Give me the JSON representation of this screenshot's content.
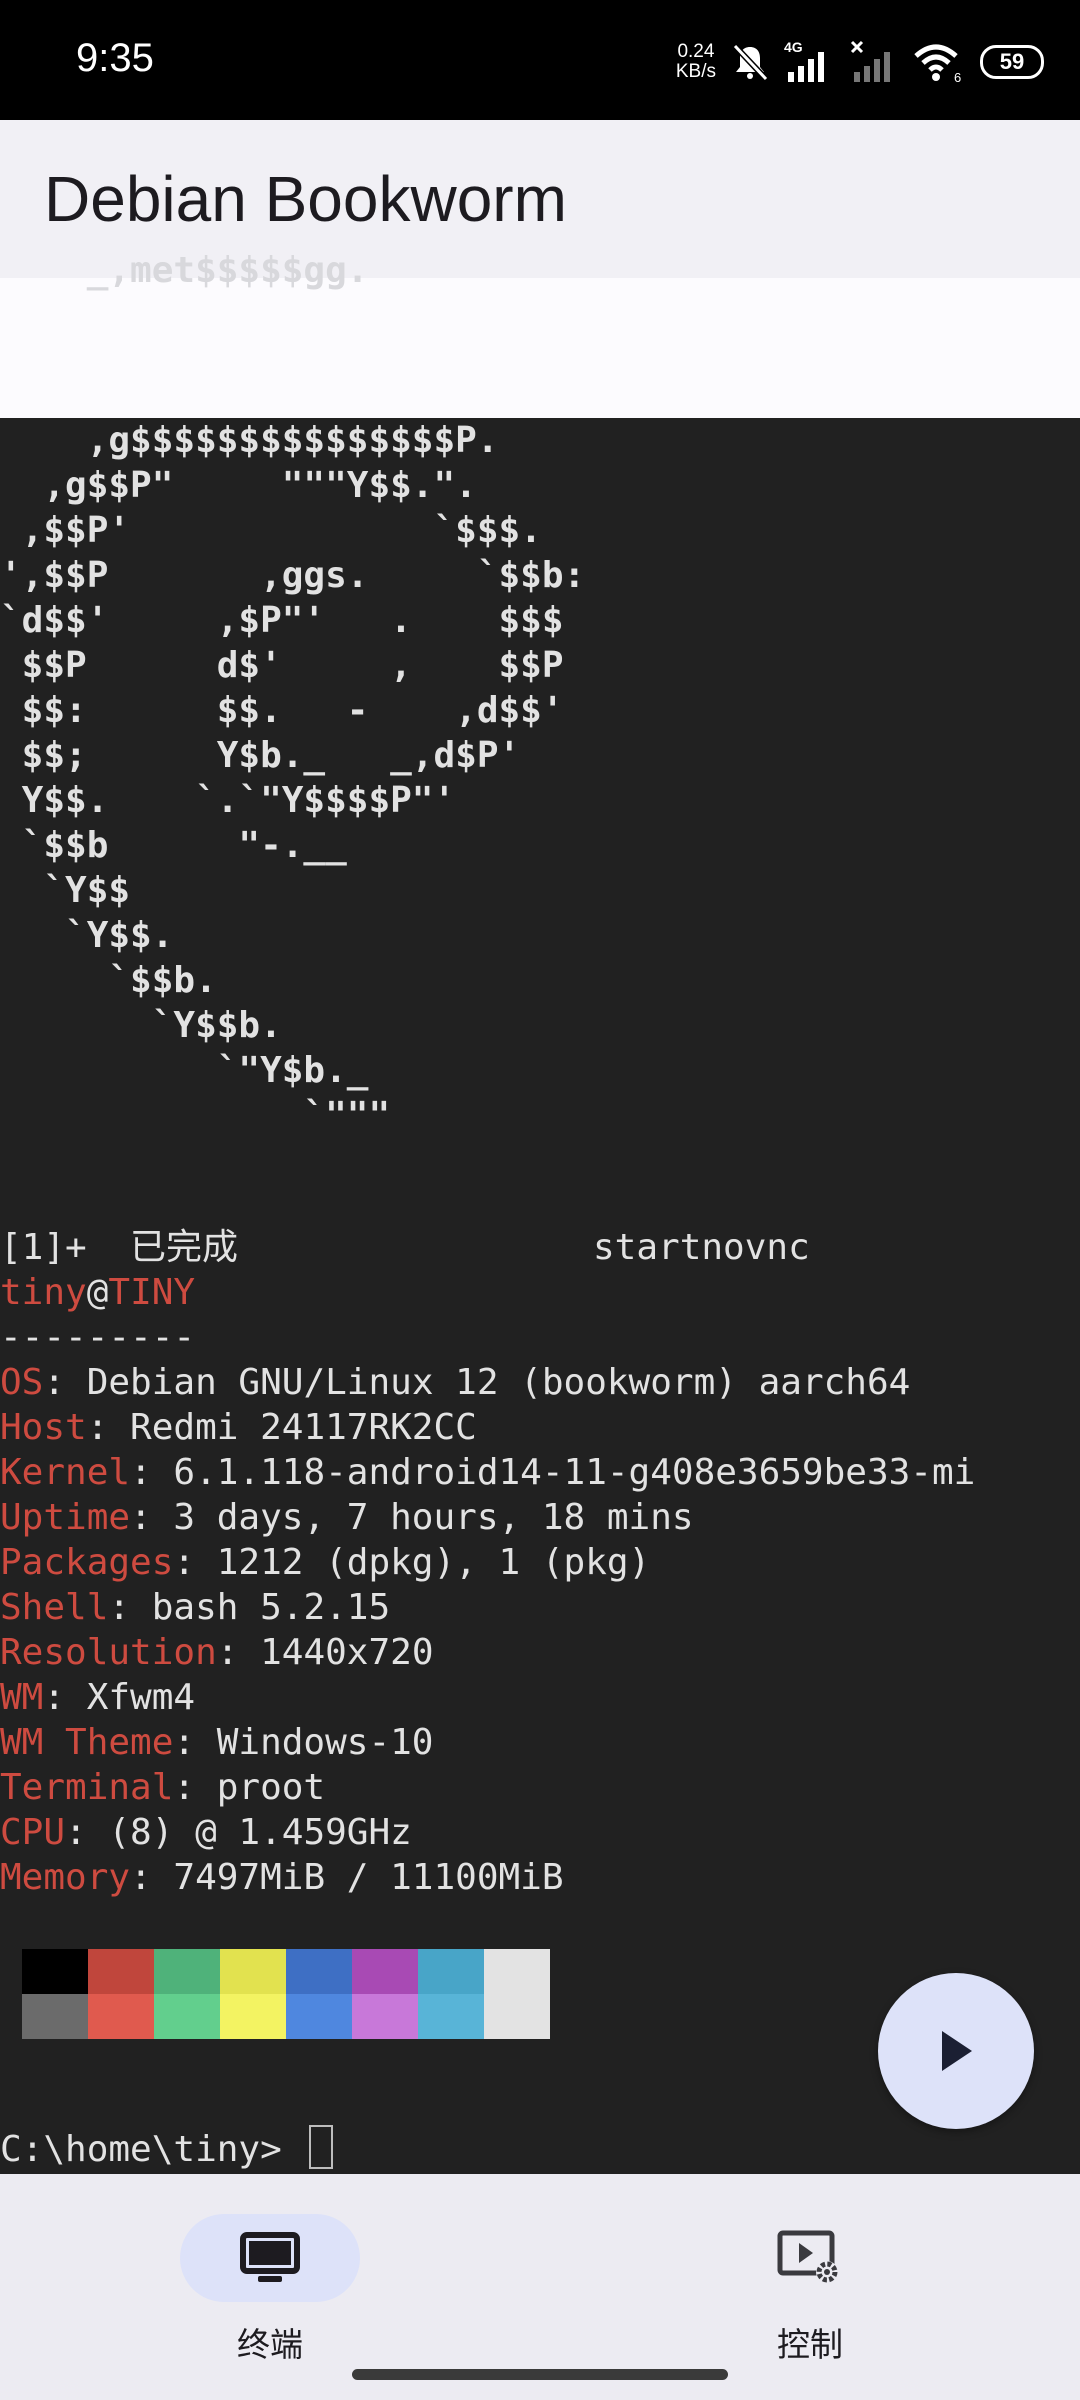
{
  "status_bar": {
    "time": "9:35",
    "net_speed_value": "0.24",
    "net_speed_unit": "KB/s",
    "network_type": "4G",
    "wifi_sub": "6",
    "battery": "59",
    "icons": [
      "mute-bell-icon",
      "signal-icon",
      "no-signal-icon",
      "wifi-icon",
      "battery-icon"
    ]
  },
  "app_bar": {
    "title": "Debian Bookworm"
  },
  "terminal": {
    "logo_top_line": "    _,met$$$$$gg.",
    "logo_lines": [
      "    ,g$$$$$$$$$$$$$$$P.",
      "  ,g$$P\"     \"\"\"Y$$.\".",
      " ,$$P'              `$$$.",
      "',$$P       ,ggs.     `$$b:",
      "`d$$'     ,$P\"'   .    $$$",
      " $$P      d$'     ,    $$P",
      " $$:      $$.   -    ,d$$'",
      " $$;      Y$b._   _,d$P'",
      " Y$$.    `.`\"Y$$$$P\"'",
      " `$$b      \"-.__",
      "  `Y$$",
      "   `Y$$.",
      "     `$$b.",
      "       `Y$$b.",
      "          `\"Y$b._",
      "              `\"\"\""
    ],
    "job_line_prefix": "[1]+  已完成",
    "job_line_cmd": "startnovnc",
    "user": "tiny",
    "at": "@",
    "host": "TINY",
    "separator": "---------",
    "info": [
      {
        "key": "OS",
        "value": ": Debian GNU/Linux 12 (bookworm) aarch64"
      },
      {
        "key": "Host",
        "value": ": Redmi 24117RK2CC"
      },
      {
        "key": "Kernel",
        "value": ": 6.1.118-android14-11-g408e3659be33-mi"
      },
      {
        "key": "Uptime",
        "value": ": 3 days, 7 hours, 18 mins"
      },
      {
        "key": "Packages",
        "value": ": 1212 (dpkg), 1 (pkg)"
      },
      {
        "key": "Shell",
        "value": ": bash 5.2.15"
      },
      {
        "key": "Resolution",
        "value": ": 1440x720"
      },
      {
        "key": "WM",
        "value": ": Xfwm4"
      },
      {
        "key": "WM Theme",
        "value": ": Windows-10"
      },
      {
        "key": "Terminal",
        "value": ": proot"
      },
      {
        "key": "CPU",
        "value": ": (8) @ 1.459GHz"
      },
      {
        "key": "Memory",
        "value": ": 7497MiB / 11100MiB"
      }
    ],
    "palette_top": [
      "#000000",
      "#c0463c",
      "#4fb27a",
      "#e2e24f",
      "#3e6fc4",
      "#a84ab4",
      "#48a5c8",
      "#e3e3e3"
    ],
    "palette_bottom": [
      "#6b6b6b",
      "#e05a4e",
      "#62cf8d",
      "#f3f362",
      "#4f87df",
      "#c878d9",
      "#58b4d7",
      "#e3e3e3"
    ],
    "prompt": "C:\\home\\tiny> "
  },
  "fab": {
    "icon": "play-icon"
  },
  "bottom_nav": {
    "items": [
      {
        "label": "终端",
        "icon": "terminal-monitor-icon",
        "active": true
      },
      {
        "label": "控制",
        "icon": "video-settings-icon",
        "active": false
      }
    ]
  }
}
